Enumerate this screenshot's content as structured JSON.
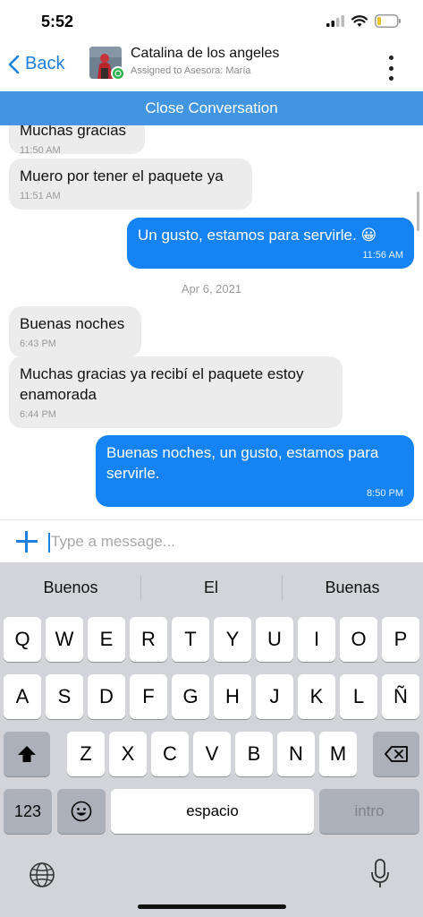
{
  "status_bar": {
    "time": "5:52"
  },
  "header": {
    "back_label": "Back",
    "contact_name": "Catalina de los angeles",
    "assigned": "Assigned to Asesora: María",
    "close_conversation": "Close Conversation"
  },
  "messages": [
    {
      "dir": "in",
      "text": "Muchas gracias",
      "time": "11:50 AM"
    },
    {
      "dir": "in",
      "text": "Muero por tener el paquete ya",
      "time": "11:51 AM"
    },
    {
      "dir": "out",
      "text": "Un gusto, estamos para servirle. 😀",
      "time": "11:56 AM"
    },
    {
      "dir": "in",
      "text": "Buenas noches",
      "time": "6:43 PM"
    },
    {
      "dir": "in",
      "text": "Muchas gracias ya recibí el paquete estoy enamorada",
      "time": "6:44 PM"
    },
    {
      "dir": "out",
      "text": "Buenas noches, un gusto, estamos para servirle.",
      "time": "8:50 PM"
    }
  ],
  "date_separator": "Apr 6, 2021",
  "composer": {
    "placeholder": "Type a message..."
  },
  "keyboard": {
    "suggestions": [
      "Buenos",
      "El",
      "Buenas"
    ],
    "row1": [
      "Q",
      "W",
      "E",
      "R",
      "T",
      "Y",
      "U",
      "I",
      "O",
      "P"
    ],
    "row2": [
      "A",
      "S",
      "D",
      "F",
      "G",
      "H",
      "J",
      "K",
      "L",
      "Ñ"
    ],
    "row3": [
      "Z",
      "X",
      "C",
      "V",
      "B",
      "N",
      "M"
    ],
    "numbers_key": "123",
    "space_key": "espacio",
    "return_key": "intro"
  },
  "icons": {
    "back": "chevron-left-icon",
    "menu": "kebab-menu-icon",
    "add": "plus-icon",
    "globe": "globe-icon",
    "mic": "microphone-icon",
    "shift": "shift-icon",
    "delete": "backspace-icon",
    "emoji": "emoji-icon",
    "whatsapp": "whatsapp-icon"
  },
  "colors": {
    "accent": "#1d7fe0",
    "close_bar": "#4296e1",
    "outgoing_bubble": "#1583f3",
    "incoming_bubble": "#ececec"
  }
}
